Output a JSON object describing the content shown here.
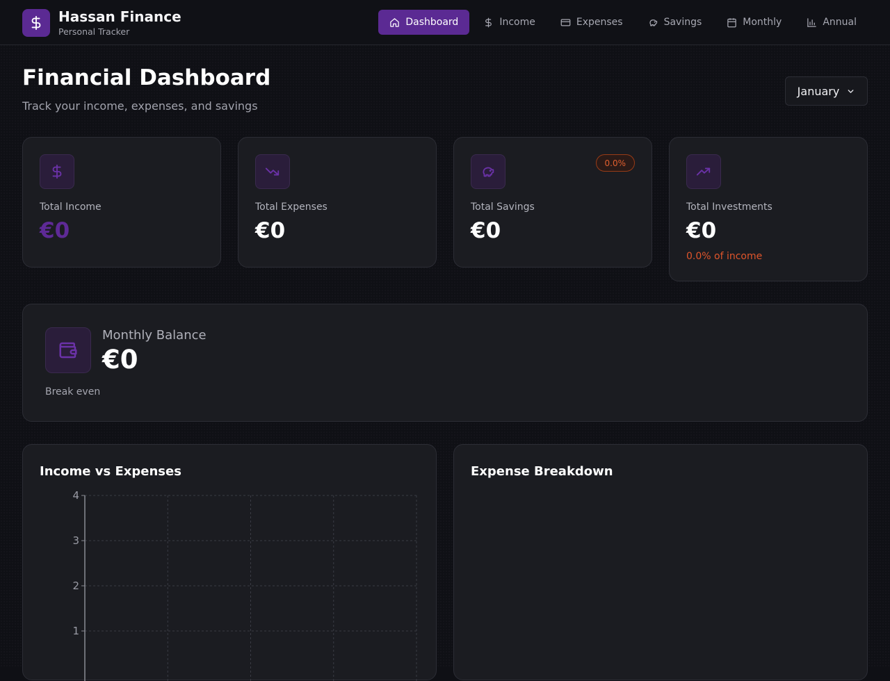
{
  "header": {
    "brand_name": "Hassan Finance",
    "brand_subtitle": "Personal Tracker",
    "brand_icon": "dollar-icon",
    "nav": [
      {
        "label": "Dashboard",
        "icon": "home-icon",
        "active": true
      },
      {
        "label": "Income",
        "icon": "dollar-icon",
        "active": false
      },
      {
        "label": "Expenses",
        "icon": "credit-card-icon",
        "active": false
      },
      {
        "label": "Savings",
        "icon": "piggy-bank-icon",
        "active": false
      },
      {
        "label": "Monthly",
        "icon": "calendar-icon",
        "active": false
      },
      {
        "label": "Annual",
        "icon": "bar-chart-icon",
        "active": false
      }
    ]
  },
  "page": {
    "title": "Financial Dashboard",
    "subtitle": "Track your income, expenses, and savings",
    "month_selected": "January"
  },
  "stats": {
    "income": {
      "label": "Total Income",
      "value": "€0",
      "icon": "dollar-icon"
    },
    "expenses": {
      "label": "Total Expenses",
      "value": "€0",
      "icon": "trending-down-icon"
    },
    "savings": {
      "label": "Total Savings",
      "value": "€0",
      "badge": "0.0%",
      "icon": "piggy-bank-icon"
    },
    "investments": {
      "label": "Total Investments",
      "value": "€0",
      "note": "0.0% of income",
      "icon": "trending-up-icon"
    }
  },
  "balance": {
    "label": "Monthly Balance",
    "value": "€0",
    "status": "Break even",
    "icon": "wallet-icon"
  },
  "charts": {
    "income_vs_expenses_title": "Income vs Expenses",
    "expense_breakdown_title": "Expense Breakdown"
  },
  "chart_data": {
    "type": "bar",
    "categories": [],
    "series": [],
    "ylim": [
      0,
      4
    ],
    "yticks": [
      1,
      2,
      3,
      4
    ],
    "grid": true
  },
  "colors": {
    "accent": "#5b2a93",
    "warning": "#e0552b",
    "background": "#0f1015",
    "card": "#1b1c21"
  }
}
